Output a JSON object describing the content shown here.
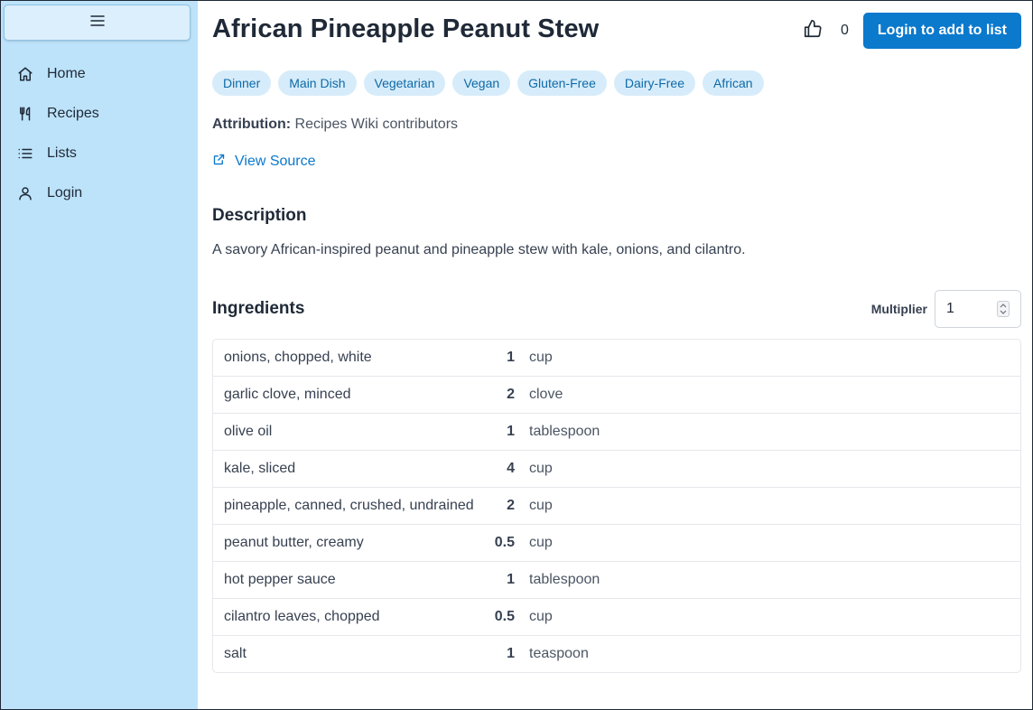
{
  "sidebar": {
    "items": [
      {
        "label": "Home",
        "icon": "home-icon"
      },
      {
        "label": "Recipes",
        "icon": "utensils-icon"
      },
      {
        "label": "Lists",
        "icon": "list-icon"
      },
      {
        "label": "Login",
        "icon": "user-icon"
      }
    ]
  },
  "recipe": {
    "title": "African Pineapple Peanut Stew",
    "like_count": "0",
    "login_button": "Login to add to list",
    "tags": [
      "Dinner",
      "Main Dish",
      "Vegetarian",
      "Vegan",
      "Gluten-Free",
      "Dairy-Free",
      "African"
    ],
    "attribution_label": "Attribution:",
    "attribution_value": "Recipes Wiki contributors",
    "view_source": "View Source",
    "description_title": "Description",
    "description": "A savory African-inspired peanut and pineapple stew with kale, onions, and cilantro.",
    "ingredients_title": "Ingredients",
    "multiplier_label": "Multiplier",
    "multiplier_value": "1",
    "ingredients": [
      {
        "name": "onions, chopped, white",
        "qty": "1",
        "unit": "cup"
      },
      {
        "name": "garlic clove, minced",
        "qty": "2",
        "unit": "clove"
      },
      {
        "name": "olive oil",
        "qty": "1",
        "unit": "tablespoon"
      },
      {
        "name": "kale, sliced",
        "qty": "4",
        "unit": "cup"
      },
      {
        "name": "pineapple, canned, crushed, undrained",
        "qty": "2",
        "unit": "cup"
      },
      {
        "name": "peanut butter, creamy",
        "qty": "0.5",
        "unit": "cup"
      },
      {
        "name": "hot pepper sauce",
        "qty": "1",
        "unit": "tablespoon"
      },
      {
        "name": "cilantro leaves, chopped",
        "qty": "0.5",
        "unit": "cup"
      },
      {
        "name": "salt",
        "qty": "1",
        "unit": "teaspoon"
      }
    ]
  },
  "colors": {
    "sidebar_bg": "#bde3fa",
    "accent": "#0b79cc",
    "tag_bg": "#d6ecfa",
    "tag_text": "#0e6aa8"
  }
}
